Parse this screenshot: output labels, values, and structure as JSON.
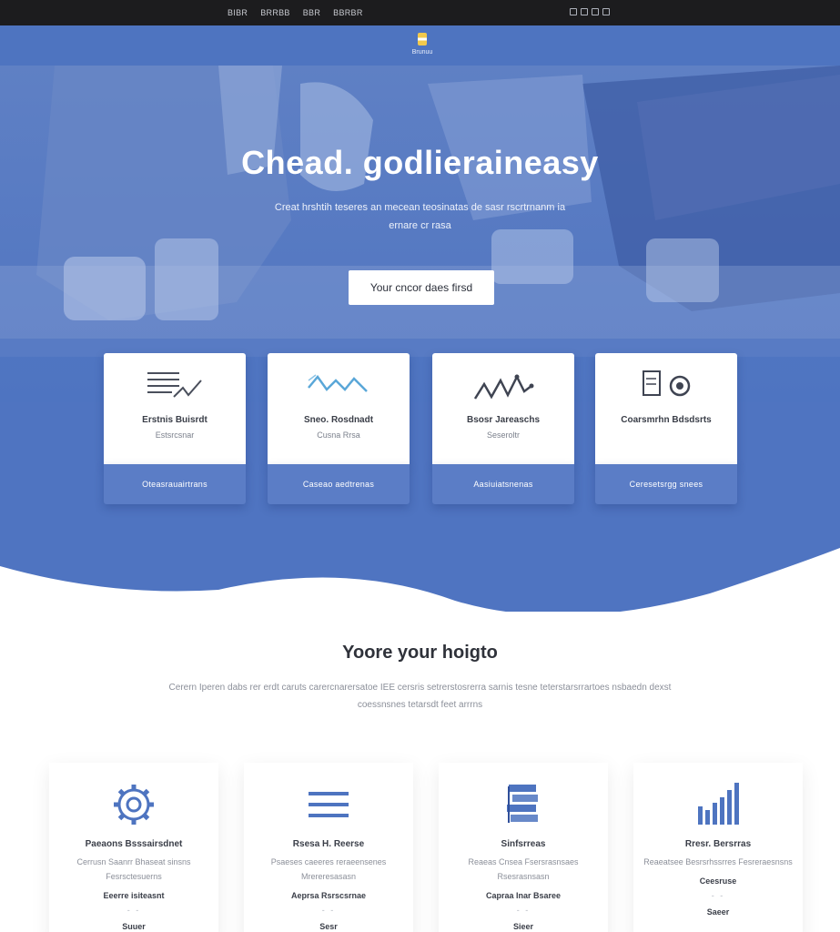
{
  "topbar": {
    "nav": [
      "BIBR",
      "BRRBB",
      "BBR",
      "BBRBR"
    ]
  },
  "brand": {
    "name": "Brunuu"
  },
  "hero": {
    "title": "Chead. godlieraineasy",
    "subtitle": "Creat hrshtih teseres an mecean teosinatas de sasr rscrtrnanm ia ernare cr rasa",
    "button_label": "Your cncor daes firsd"
  },
  "services": [
    {
      "title": "Erstnis Buisrdt",
      "sub": "Estsrcsnar",
      "footer": "Oteasrauairtrans"
    },
    {
      "title": "Sneo. Rosdnadt",
      "sub": "Cusna Rrsa",
      "footer": "Caseao aedtrenas"
    },
    {
      "title": "Bsosr Jareaschs",
      "sub": "Seseroltr",
      "footer": "Aasiuiatsnenas"
    },
    {
      "title": "Coarsmrhn Bdsdsrts",
      "sub": "",
      "footer": "Ceresetsrgg snees"
    }
  ],
  "section": {
    "title": "Yoore your hoigto",
    "text": "Cerern Iperen dabs rer erdt caruts carercnarersatoe IEE cersris setrerstosrerra sarnis tesne teterstarsrrartoes nsbaedn dexst coessnsnes tetarsdt feet arrrns"
  },
  "features": [
    {
      "title": "Paeaons Bsssairsdnet",
      "desc": "Cerrusn Saanrr Bhaseat sinsns Fesrsctesuerns",
      "link": "Eeerre isiteasnt",
      "dots": "- -",
      "more": "Suuer"
    },
    {
      "title": "Rsesa H. Reerse",
      "desc": "Psaeses caeeres reraeensenes Mrereresasasn",
      "link": "Aeprsa Rsrscsrnae",
      "dots": "- -",
      "more": "Sesr"
    },
    {
      "title": "Sinfsrreas",
      "desc": "Reaeas Cnsea Fsersrasnsaes Rsesrasnsasn",
      "link": "Capraa Inar Bsaree",
      "dots": "- -",
      "more": "Sieer"
    },
    {
      "title": "Rresr. Bersrras",
      "desc": "Reaeatsee Besrsrhssrres Fesreraesnsns",
      "link": "Ceesruse",
      "dots": "- -",
      "more": "Saeer"
    }
  ],
  "colors": {
    "primary": "#4f74c1",
    "dark": "#1c1c1e",
    "accent_gold": "#f2c94c"
  }
}
